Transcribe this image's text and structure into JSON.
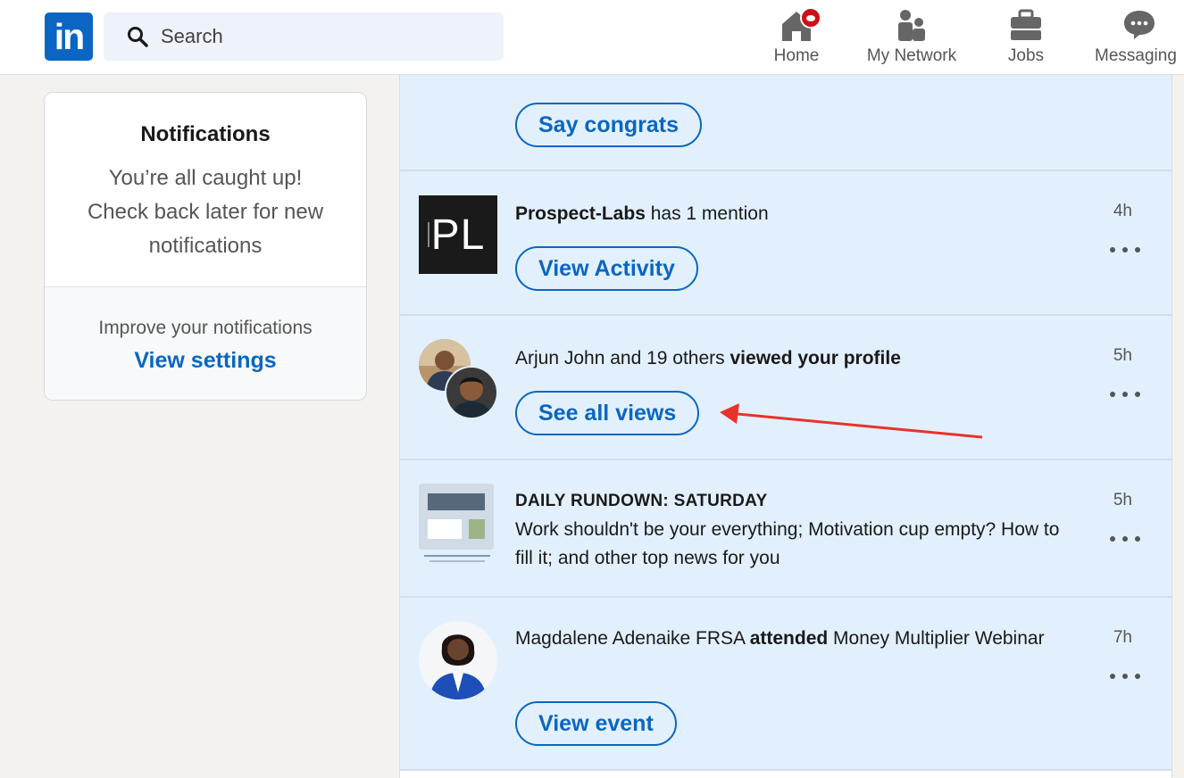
{
  "nav": {
    "logo_text": "in",
    "search_placeholder": "Search",
    "items": [
      {
        "label": "Home",
        "icon": "home-icon",
        "has_badge": true
      },
      {
        "label": "My Network",
        "icon": "network-icon"
      },
      {
        "label": "Jobs",
        "icon": "briefcase-icon"
      },
      {
        "label": "Messaging",
        "icon": "messaging-icon"
      }
    ]
  },
  "sidebar": {
    "title": "Notifications",
    "message_lines": [
      "You’re all caught up!",
      "Check back later for new",
      "notifications"
    ],
    "improve_text": "Improve your notifications",
    "settings_link": "View settings"
  },
  "feed": {
    "notifications": [
      {
        "button": "Say congrats"
      },
      {
        "actor": "Prospect-Labs",
        "text": " has 1 mention",
        "logo_text": "PL",
        "time": "4h",
        "button": "View Activity"
      },
      {
        "text_pre": "Arjun John and 19 others ",
        "text_bold": "viewed your profile",
        "time": "5h",
        "button": "See all views"
      },
      {
        "heading": "DAILY RUNDOWN: SATURDAY",
        "body": "Work shouldn't be your everything; Motivation cup empty? How to fill it; and other top news for you",
        "time": "5h"
      },
      {
        "text_pre": "Magdalene Adenaike FRSA ",
        "text_bold": "attended",
        "text_post": " Money Multiplier Webinar",
        "time": "7h",
        "button": "View event"
      }
    ]
  },
  "colors": {
    "brand": "#0a66c2",
    "notification_bg": "#e2f0fe",
    "badge": "#cc1016",
    "annotation_arrow": "#e8322c"
  }
}
